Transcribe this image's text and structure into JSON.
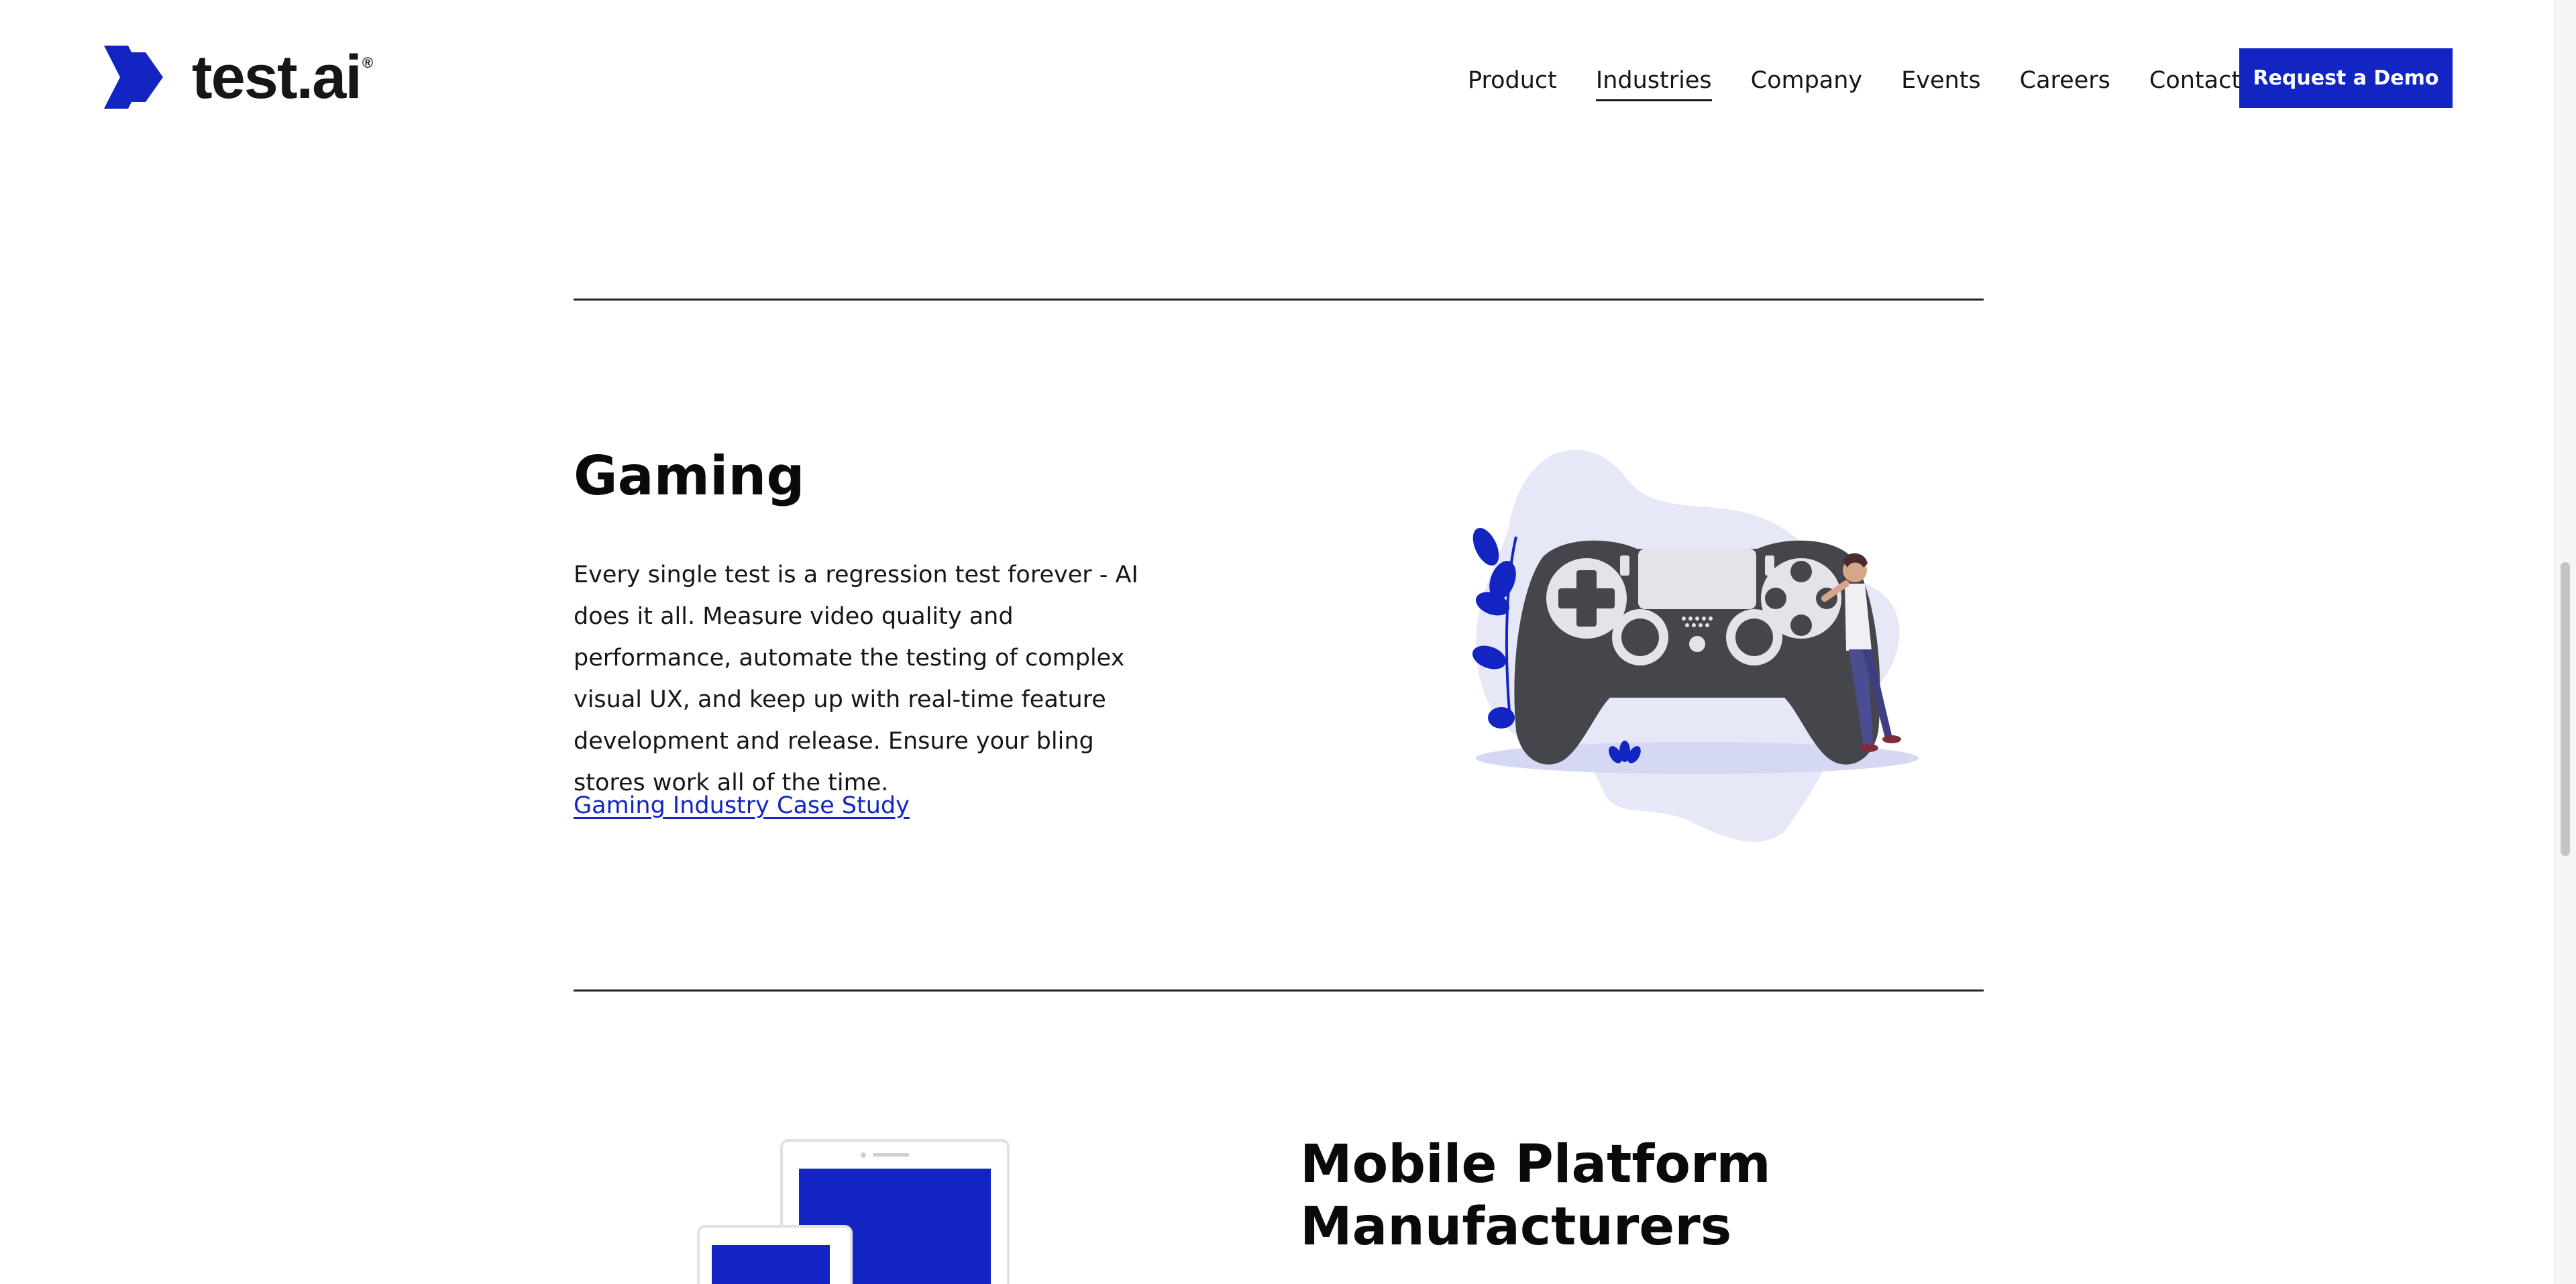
{
  "header": {
    "logo_text": "test.ai",
    "logo_reg": "®",
    "nav": [
      {
        "label": "Product",
        "active": false
      },
      {
        "label": "Industries",
        "active": true
      },
      {
        "label": "Company",
        "active": false
      },
      {
        "label": "Events",
        "active": false
      },
      {
        "label": "Careers",
        "active": false
      },
      {
        "label": "Contact",
        "active": false
      }
    ],
    "cta_label": "Request a Demo"
  },
  "gaming": {
    "title": "Gaming",
    "body": "Every single test is a regression test forever - AI does it all. Measure video quality and performance, automate the testing of complex visual UX, and keep up with real-time feature development and release. Ensure your bling stores work all of the time.",
    "link_label": "Gaming Industry Case Study",
    "illustration_icon": "gamepad-illustration"
  },
  "mobile": {
    "title_line1": "Mobile Platform",
    "title_line2": "Manufacturers",
    "illustration_icon": "devices-illustration"
  },
  "colors": {
    "brand_blue": "#1225c2",
    "text": "#161616",
    "blob": "#e6e8f8",
    "controller": "#45464c"
  }
}
